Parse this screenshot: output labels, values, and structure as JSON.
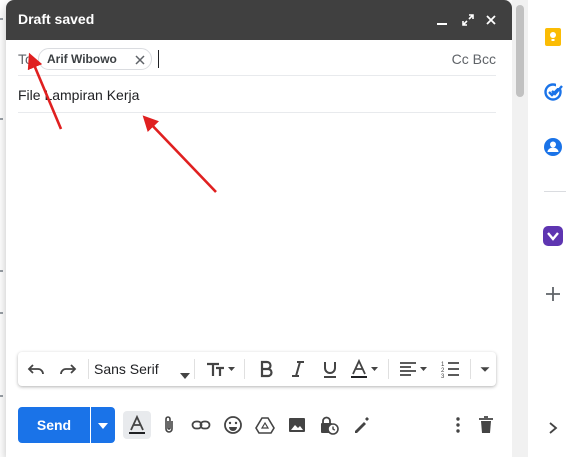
{
  "compose": {
    "title": "Draft saved",
    "to_label": "To",
    "recipient": "Arif Wibowo",
    "cc_bcc": "Cc Bcc",
    "subject": "File Lampiran Kerja",
    "body": ""
  },
  "format_toolbar": {
    "font": "Sans Serif",
    "icons": [
      "undo-icon",
      "redo-icon",
      "font-size-icon",
      "bold-icon",
      "italic-icon",
      "underline-icon",
      "text-color-icon",
      "align-icon",
      "numbered-list-icon",
      "more-formatting-icon"
    ]
  },
  "actions": {
    "send_label": "Send",
    "icons": [
      "formatting-options-icon",
      "attach-icon",
      "link-icon",
      "emoji-icon",
      "drive-icon",
      "photo-icon",
      "confidential-icon",
      "signature-icon",
      "more-options-icon",
      "discard-icon"
    ]
  },
  "side_panel": {
    "icons": [
      "keep-icon",
      "tasks-icon",
      "contacts-icon",
      "addon-icon",
      "add-icon",
      "expand-icon"
    ],
    "colors": {
      "keep": "#fbbc04",
      "tasks": "#1a73e8",
      "contacts": "#1a73e8",
      "addon": "#5e35b1"
    }
  },
  "colors": {
    "header": "#404040",
    "send": "#1a73e8",
    "annotation_arrow": "#e02020"
  }
}
